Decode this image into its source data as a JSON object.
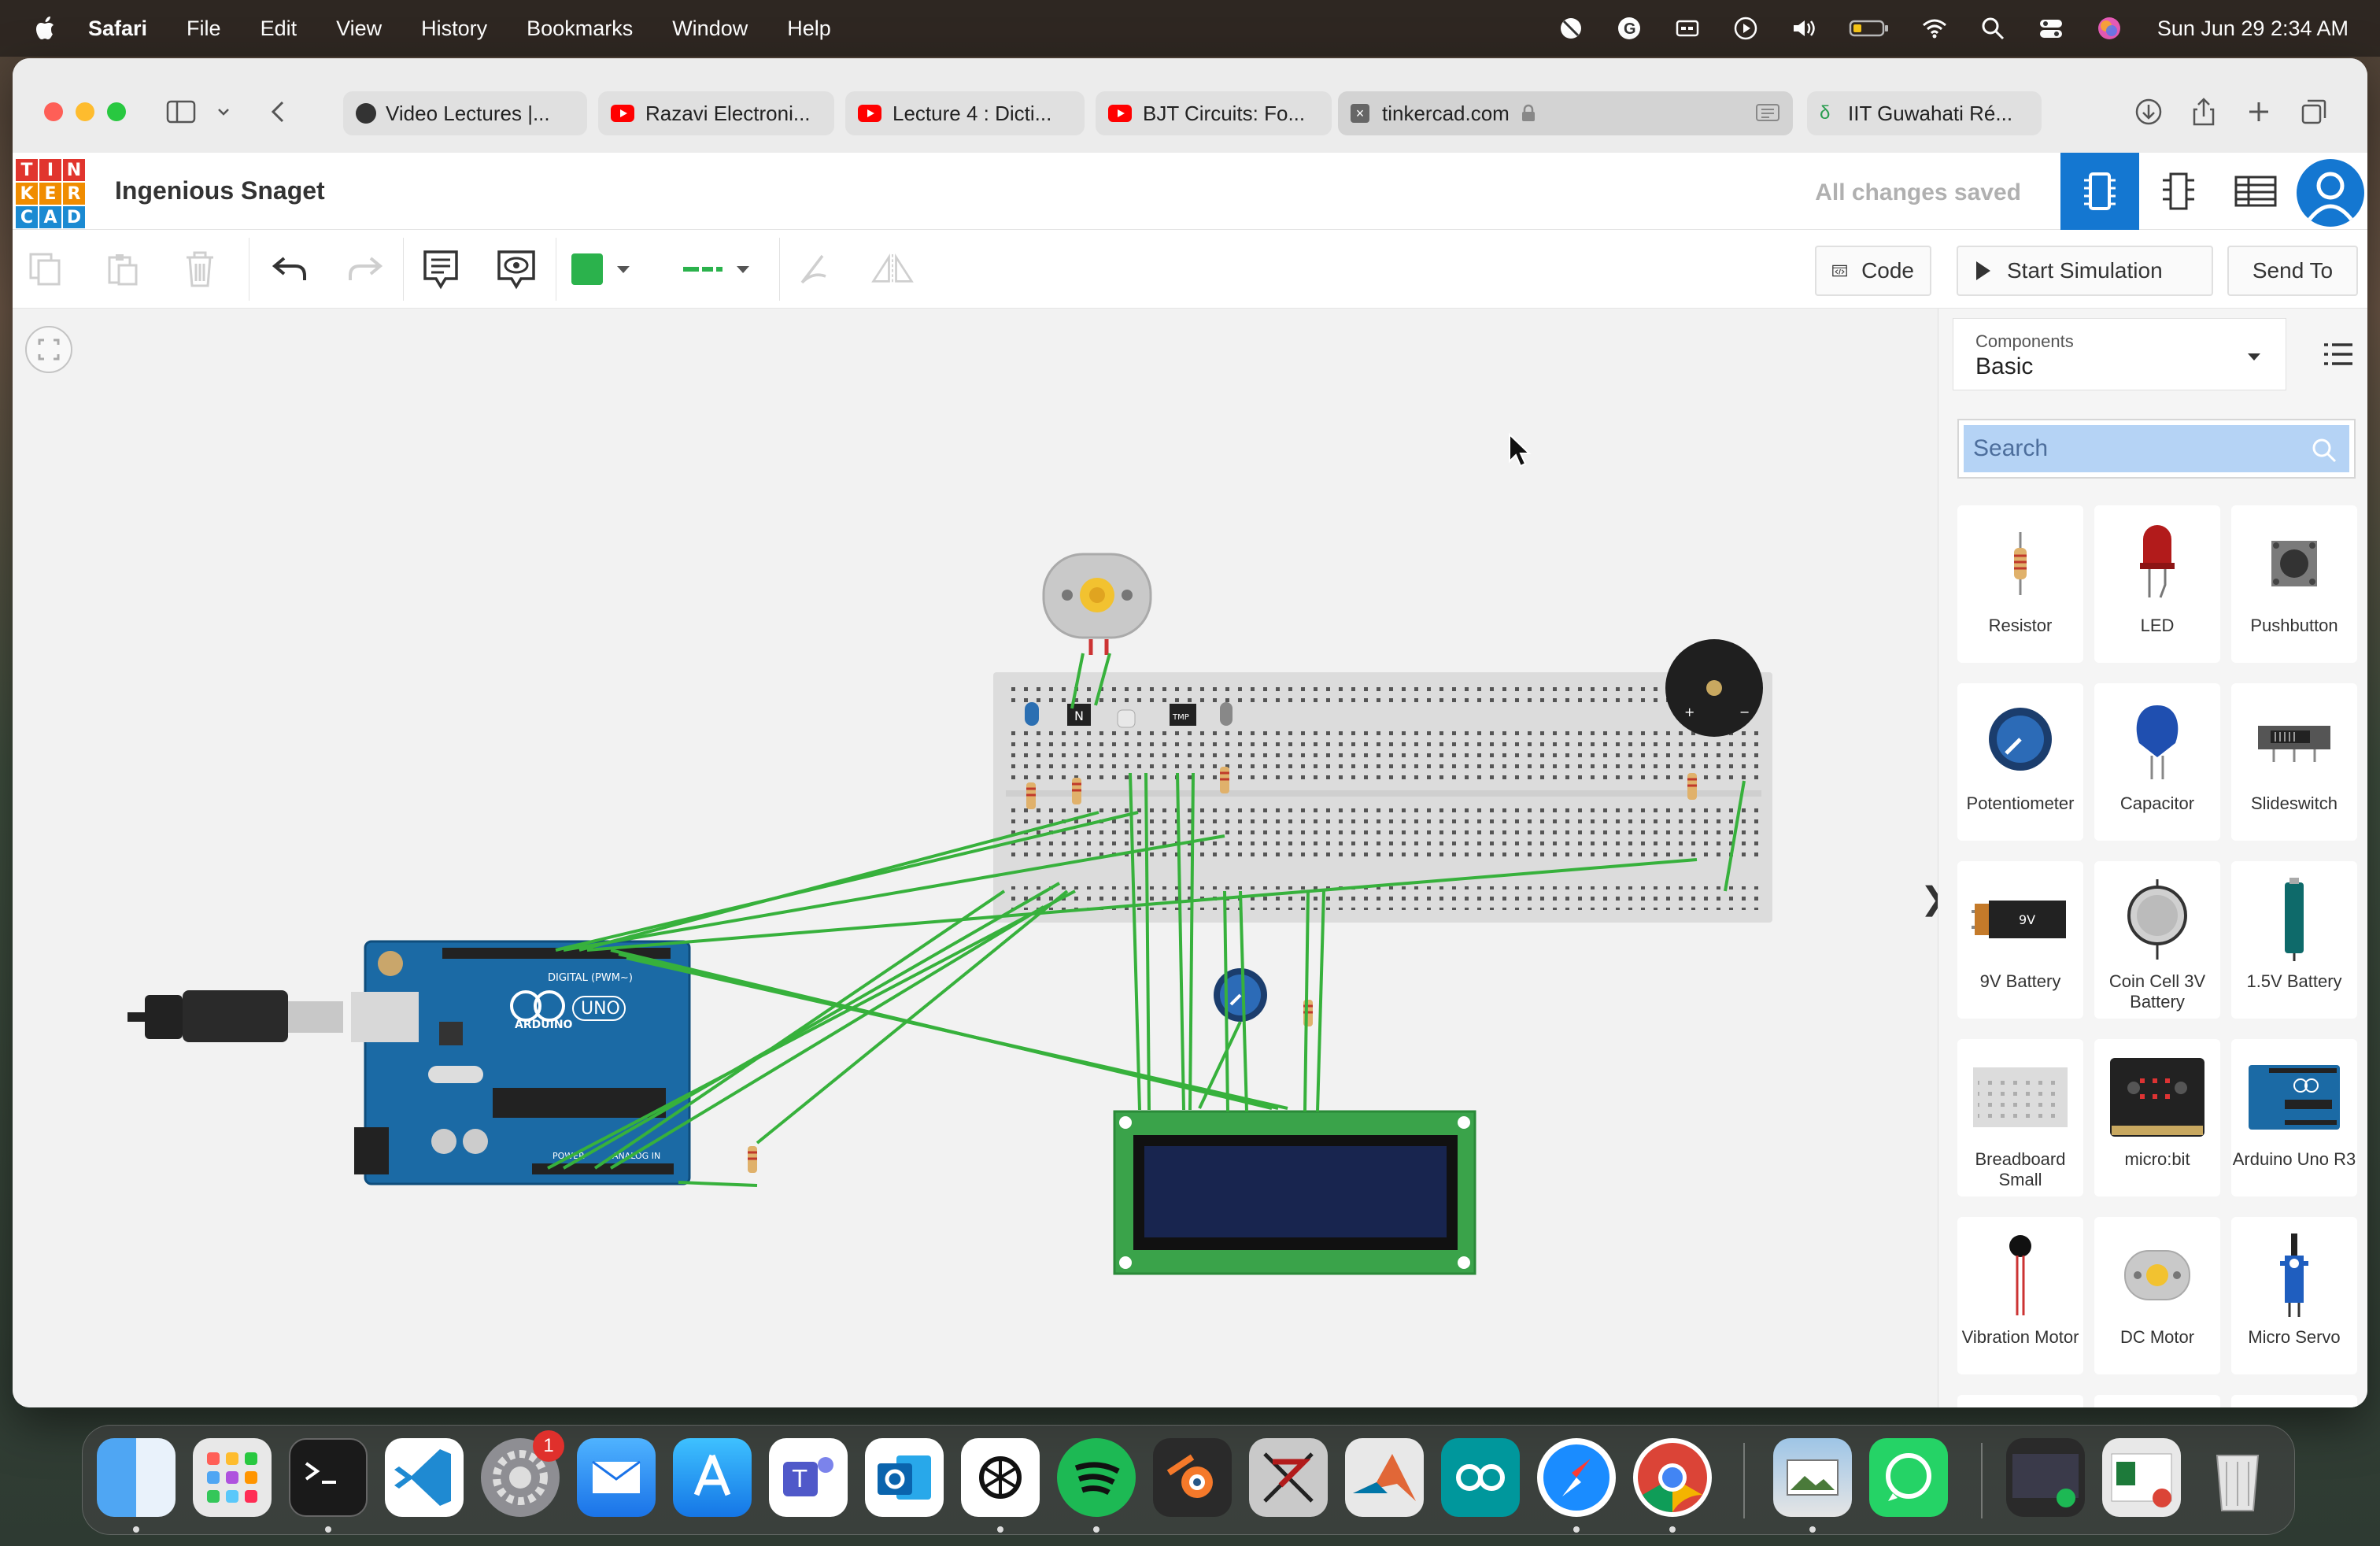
{
  "menubar": {
    "app_name": "Safari",
    "items": [
      "File",
      "Edit",
      "View",
      "History",
      "Bookmarks",
      "Window",
      "Help"
    ],
    "clock": "Sun Jun 29  2:34 AM"
  },
  "browser": {
    "tabs": [
      {
        "title": "Video Lectures |..."
      },
      {
        "title": "Razavi Electroni..."
      },
      {
        "title": "Lecture 4 : Dicti..."
      },
      {
        "title": "BJT Circuits: Fo..."
      },
      {
        "title": "tinkercad.com"
      },
      {
        "title": "IIT Guwahati Ré..."
      }
    ]
  },
  "tinkercad": {
    "logo": [
      "T",
      "I",
      "N",
      "K",
      "E",
      "R",
      "C",
      "A",
      "D"
    ],
    "logo_colors": [
      "#e1352e",
      "#e1352e",
      "#e1352e",
      "#f08c00",
      "#f08c00",
      "#f08c00",
      "#1b8ad2",
      "#1b8ad2",
      "#1b8ad2"
    ],
    "design_title": "Ingenious Snaget",
    "save_status": "All changes saved",
    "toolbar": {
      "wire_color": "#2bb24c",
      "code_label": "Code",
      "start_simulation_label": "Start Simulation",
      "send_to_label": "Send To"
    },
    "panel": {
      "components_caption": "Components",
      "components_value": "Basic",
      "search_placeholder": "Search",
      "components": [
        {
          "label": "Resistor",
          "icon": "resistor-icon"
        },
        {
          "label": "LED",
          "icon": "led-icon"
        },
        {
          "label": "Pushbutton",
          "icon": "pushbutton-icon"
        },
        {
          "label": "Potentiometer",
          "icon": "potentiometer-icon"
        },
        {
          "label": "Capacitor",
          "icon": "capacitor-icon"
        },
        {
          "label": "Slideswitch",
          "icon": "slideswitch-icon"
        },
        {
          "label": "9V Battery",
          "icon": "battery-9v-icon"
        },
        {
          "label": "Coin Cell 3V Battery",
          "icon": "coin-cell-icon"
        },
        {
          "label": "1.5V Battery",
          "icon": "battery-aa-icon"
        },
        {
          "label": "Breadboard Small",
          "icon": "breadboard-icon"
        },
        {
          "label": "micro:bit",
          "icon": "microbit-icon"
        },
        {
          "label": "Arduino Uno R3",
          "icon": "arduino-icon"
        },
        {
          "label": "Vibration Motor",
          "icon": "vibration-motor-icon"
        },
        {
          "label": "DC Motor",
          "icon": "dc-motor-icon"
        },
        {
          "label": "Micro Servo",
          "icon": "micro-servo-icon"
        }
      ]
    },
    "circuit": {
      "arduino_labels": [
        "DIGITAL (PWM~)",
        "ARDUINO",
        "UNO",
        "POWER",
        "ANALOG IN"
      ],
      "battery_9v_text": "9V",
      "transistor_mark": "N",
      "sensor_mark": "TMP"
    }
  },
  "dock": {
    "apps": [
      "Finder",
      "Launchpad",
      "Terminal",
      "Visual Studio Code",
      "System Settings",
      "Mail",
      "App Store",
      "Microsoft Teams",
      "Microsoft Outlook",
      "ChatGPT",
      "Spotify",
      "Blender",
      "LTspice",
      "MATLAB",
      "Arduino IDE",
      "Safari",
      "Google Chrome",
      "Preview",
      "WhatsApp",
      "Recent Window",
      "Recent Document",
      "Trash"
    ],
    "settings_badge": "1"
  }
}
